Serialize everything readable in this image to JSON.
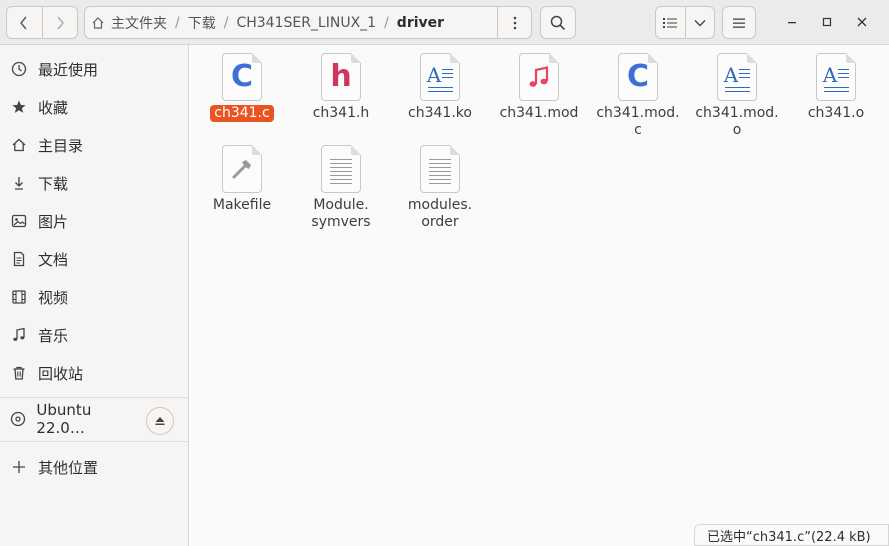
{
  "path": {
    "home_label": "主文件夹",
    "crumbs": [
      "下载",
      "CH341SER_LINUX_1",
      "driver"
    ]
  },
  "sidebar": {
    "items": [
      {
        "label": "最近使用",
        "icon": "clock-icon"
      },
      {
        "label": "收藏",
        "icon": "star-icon"
      },
      {
        "label": "主目录",
        "icon": "home-icon"
      },
      {
        "label": "下载",
        "icon": "download-icon"
      },
      {
        "label": "图片",
        "icon": "image-icon"
      },
      {
        "label": "文档",
        "icon": "document-icon"
      },
      {
        "label": "视频",
        "icon": "film-icon"
      },
      {
        "label": "音乐",
        "icon": "music-icon"
      },
      {
        "label": "回收站",
        "icon": "trash-icon"
      }
    ],
    "device": {
      "label": "Ubuntu 22.0…",
      "icon": "disc-icon"
    },
    "other": {
      "label": "其他位置",
      "icon": "plus-icon"
    }
  },
  "files": [
    {
      "name": "ch341.c",
      "type": "c-source",
      "selected": true
    },
    {
      "name": "ch341.h",
      "type": "c-header"
    },
    {
      "name": "ch341.ko",
      "type": "text-doc"
    },
    {
      "name": "ch341.mod",
      "type": "audio"
    },
    {
      "name": "ch341.mod.\nc",
      "type": "c-source"
    },
    {
      "name": "ch341.mod.\no",
      "type": "text-doc"
    },
    {
      "name": "ch341.o",
      "type": "text-doc"
    },
    {
      "name": "Makefile",
      "type": "makefile"
    },
    {
      "name": "Module.\nsymvers",
      "type": "plain"
    },
    {
      "name": "modules.\norder",
      "type": "plain"
    }
  ],
  "status": {
    "text": "已选中“ch341.c”(22.4 kB)"
  },
  "colors": {
    "accent": "#e95420",
    "c_blue": "#3f6fd6",
    "h_red": "#d1355b",
    "music_red": "#e8465c"
  }
}
